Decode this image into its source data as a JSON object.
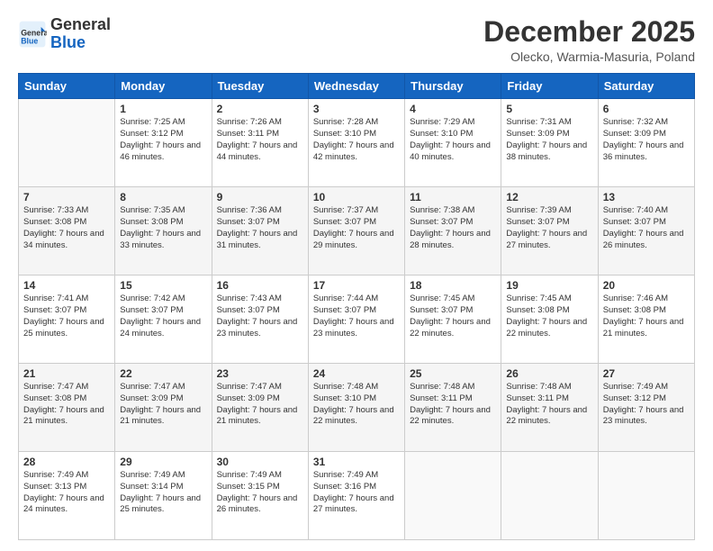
{
  "header": {
    "logo_general": "General",
    "logo_blue": "Blue",
    "month_year": "December 2025",
    "location": "Olecko, Warmia-Masuria, Poland"
  },
  "weekdays": [
    "Sunday",
    "Monday",
    "Tuesday",
    "Wednesday",
    "Thursday",
    "Friday",
    "Saturday"
  ],
  "weeks": [
    [
      {
        "day": "",
        "sunrise": "",
        "sunset": "",
        "daylight": ""
      },
      {
        "day": "1",
        "sunrise": "Sunrise: 7:25 AM",
        "sunset": "Sunset: 3:12 PM",
        "daylight": "Daylight: 7 hours and 46 minutes."
      },
      {
        "day": "2",
        "sunrise": "Sunrise: 7:26 AM",
        "sunset": "Sunset: 3:11 PM",
        "daylight": "Daylight: 7 hours and 44 minutes."
      },
      {
        "day": "3",
        "sunrise": "Sunrise: 7:28 AM",
        "sunset": "Sunset: 3:10 PM",
        "daylight": "Daylight: 7 hours and 42 minutes."
      },
      {
        "day": "4",
        "sunrise": "Sunrise: 7:29 AM",
        "sunset": "Sunset: 3:10 PM",
        "daylight": "Daylight: 7 hours and 40 minutes."
      },
      {
        "day": "5",
        "sunrise": "Sunrise: 7:31 AM",
        "sunset": "Sunset: 3:09 PM",
        "daylight": "Daylight: 7 hours and 38 minutes."
      },
      {
        "day": "6",
        "sunrise": "Sunrise: 7:32 AM",
        "sunset": "Sunset: 3:09 PM",
        "daylight": "Daylight: 7 hours and 36 minutes."
      }
    ],
    [
      {
        "day": "7",
        "sunrise": "Sunrise: 7:33 AM",
        "sunset": "Sunset: 3:08 PM",
        "daylight": "Daylight: 7 hours and 34 minutes."
      },
      {
        "day": "8",
        "sunrise": "Sunrise: 7:35 AM",
        "sunset": "Sunset: 3:08 PM",
        "daylight": "Daylight: 7 hours and 33 minutes."
      },
      {
        "day": "9",
        "sunrise": "Sunrise: 7:36 AM",
        "sunset": "Sunset: 3:07 PM",
        "daylight": "Daylight: 7 hours and 31 minutes."
      },
      {
        "day": "10",
        "sunrise": "Sunrise: 7:37 AM",
        "sunset": "Sunset: 3:07 PM",
        "daylight": "Daylight: 7 hours and 29 minutes."
      },
      {
        "day": "11",
        "sunrise": "Sunrise: 7:38 AM",
        "sunset": "Sunset: 3:07 PM",
        "daylight": "Daylight: 7 hours and 28 minutes."
      },
      {
        "day": "12",
        "sunrise": "Sunrise: 7:39 AM",
        "sunset": "Sunset: 3:07 PM",
        "daylight": "Daylight: 7 hours and 27 minutes."
      },
      {
        "day": "13",
        "sunrise": "Sunrise: 7:40 AM",
        "sunset": "Sunset: 3:07 PM",
        "daylight": "Daylight: 7 hours and 26 minutes."
      }
    ],
    [
      {
        "day": "14",
        "sunrise": "Sunrise: 7:41 AM",
        "sunset": "Sunset: 3:07 PM",
        "daylight": "Daylight: 7 hours and 25 minutes."
      },
      {
        "day": "15",
        "sunrise": "Sunrise: 7:42 AM",
        "sunset": "Sunset: 3:07 PM",
        "daylight": "Daylight: 7 hours and 24 minutes."
      },
      {
        "day": "16",
        "sunrise": "Sunrise: 7:43 AM",
        "sunset": "Sunset: 3:07 PM",
        "daylight": "Daylight: 7 hours and 23 minutes."
      },
      {
        "day": "17",
        "sunrise": "Sunrise: 7:44 AM",
        "sunset": "Sunset: 3:07 PM",
        "daylight": "Daylight: 7 hours and 23 minutes."
      },
      {
        "day": "18",
        "sunrise": "Sunrise: 7:45 AM",
        "sunset": "Sunset: 3:07 PM",
        "daylight": "Daylight: 7 hours and 22 minutes."
      },
      {
        "day": "19",
        "sunrise": "Sunrise: 7:45 AM",
        "sunset": "Sunset: 3:08 PM",
        "daylight": "Daylight: 7 hours and 22 minutes."
      },
      {
        "day": "20",
        "sunrise": "Sunrise: 7:46 AM",
        "sunset": "Sunset: 3:08 PM",
        "daylight": "Daylight: 7 hours and 21 minutes."
      }
    ],
    [
      {
        "day": "21",
        "sunrise": "Sunrise: 7:47 AM",
        "sunset": "Sunset: 3:08 PM",
        "daylight": "Daylight: 7 hours and 21 minutes."
      },
      {
        "day": "22",
        "sunrise": "Sunrise: 7:47 AM",
        "sunset": "Sunset: 3:09 PM",
        "daylight": "Daylight: 7 hours and 21 minutes."
      },
      {
        "day": "23",
        "sunrise": "Sunrise: 7:47 AM",
        "sunset": "Sunset: 3:09 PM",
        "daylight": "Daylight: 7 hours and 21 minutes."
      },
      {
        "day": "24",
        "sunrise": "Sunrise: 7:48 AM",
        "sunset": "Sunset: 3:10 PM",
        "daylight": "Daylight: 7 hours and 22 minutes."
      },
      {
        "day": "25",
        "sunrise": "Sunrise: 7:48 AM",
        "sunset": "Sunset: 3:11 PM",
        "daylight": "Daylight: 7 hours and 22 minutes."
      },
      {
        "day": "26",
        "sunrise": "Sunrise: 7:48 AM",
        "sunset": "Sunset: 3:11 PM",
        "daylight": "Daylight: 7 hours and 22 minutes."
      },
      {
        "day": "27",
        "sunrise": "Sunrise: 7:49 AM",
        "sunset": "Sunset: 3:12 PM",
        "daylight": "Daylight: 7 hours and 23 minutes."
      }
    ],
    [
      {
        "day": "28",
        "sunrise": "Sunrise: 7:49 AM",
        "sunset": "Sunset: 3:13 PM",
        "daylight": "Daylight: 7 hours and 24 minutes."
      },
      {
        "day": "29",
        "sunrise": "Sunrise: 7:49 AM",
        "sunset": "Sunset: 3:14 PM",
        "daylight": "Daylight: 7 hours and 25 minutes."
      },
      {
        "day": "30",
        "sunrise": "Sunrise: 7:49 AM",
        "sunset": "Sunset: 3:15 PM",
        "daylight": "Daylight: 7 hours and 26 minutes."
      },
      {
        "day": "31",
        "sunrise": "Sunrise: 7:49 AM",
        "sunset": "Sunset: 3:16 PM",
        "daylight": "Daylight: 7 hours and 27 minutes."
      },
      {
        "day": "",
        "sunrise": "",
        "sunset": "",
        "daylight": ""
      },
      {
        "day": "",
        "sunrise": "",
        "sunset": "",
        "daylight": ""
      },
      {
        "day": "",
        "sunrise": "",
        "sunset": "",
        "daylight": ""
      }
    ]
  ]
}
